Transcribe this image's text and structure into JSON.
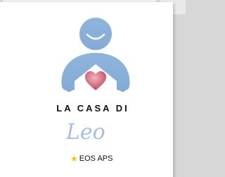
{
  "logo": {
    "title": "LA CASA DI",
    "signature": "Leo",
    "subline": "EOS APS",
    "colors": {
      "figure": "#8ab0d8",
      "heart": "#c85a6c",
      "star": "#f2c400",
      "signature": "#a3c0e4"
    },
    "icons": [
      "person-house-icon",
      "heart-icon",
      "star-icon"
    ]
  }
}
